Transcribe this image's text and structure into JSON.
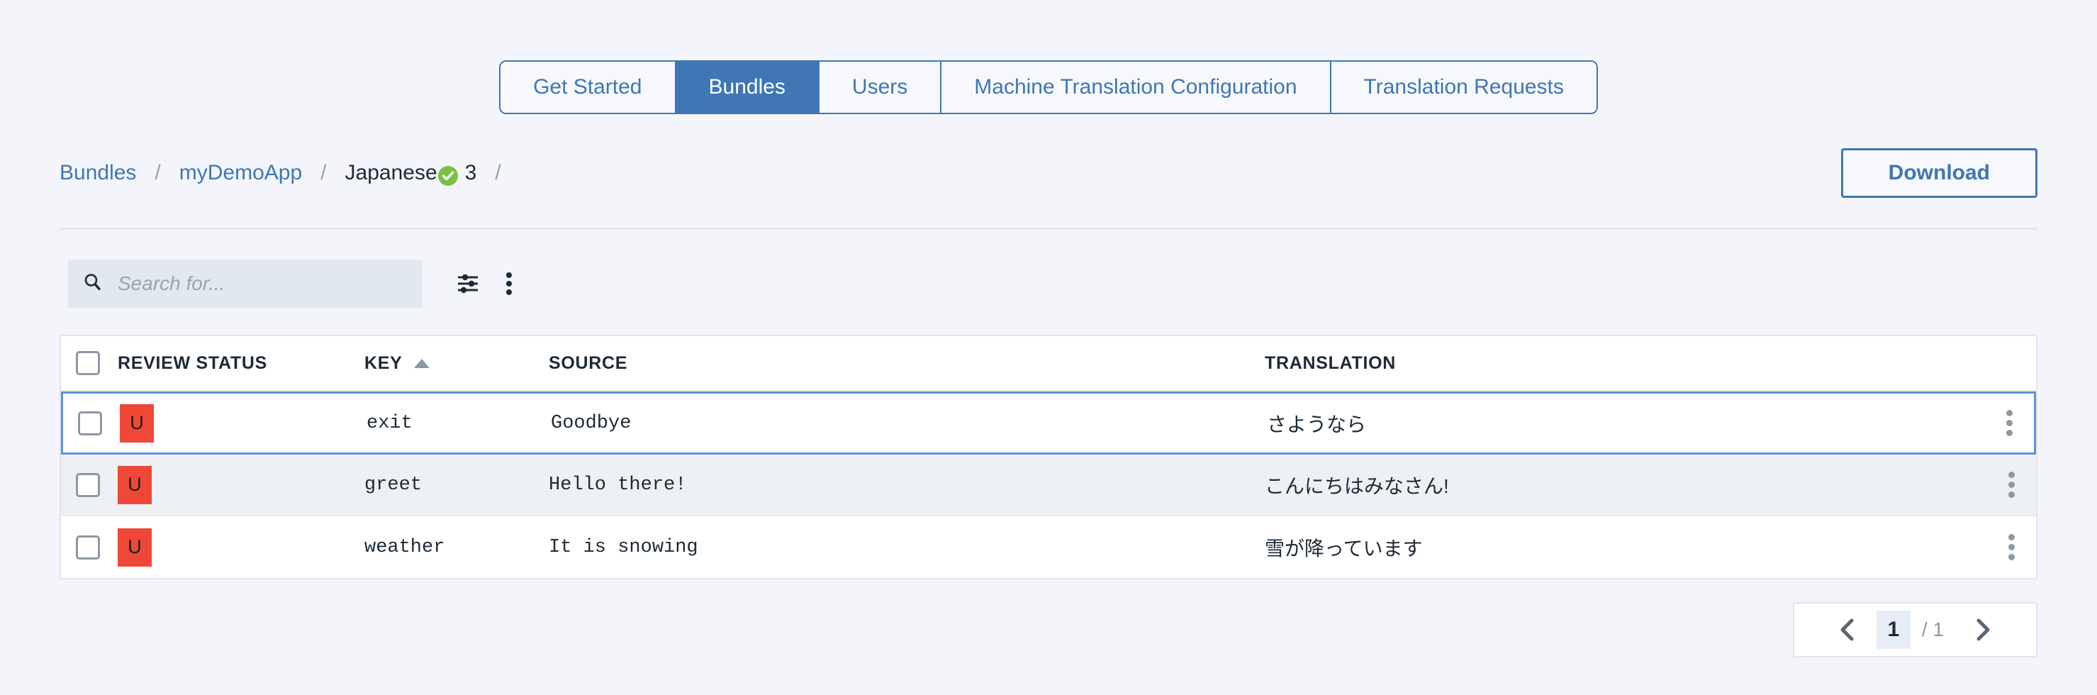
{
  "colors": {
    "accent_blue": "#3f76b5",
    "page_bg": "#f4f5fa",
    "badge_red": "#ef4836",
    "check_green": "#7ac143",
    "selected_border": "#5b93dd",
    "row_alt_bg": "#eef1f4"
  },
  "tabs": [
    {
      "label": "Get Started",
      "active": false
    },
    {
      "label": "Bundles",
      "active": true
    },
    {
      "label": "Users",
      "active": false
    },
    {
      "label": "Machine Translation Configuration",
      "active": false
    },
    {
      "label": "Translation Requests",
      "active": false
    }
  ],
  "breadcrumb": {
    "items": [
      {
        "label": "Bundles",
        "type": "link"
      },
      {
        "label": "myDemoApp",
        "type": "link"
      },
      {
        "label": "Japanese",
        "type": "current"
      }
    ],
    "separator": "/",
    "trailing_separator": "/",
    "count": "3",
    "status_icon": "check-circle-icon"
  },
  "header_actions": {
    "download_label": "Download"
  },
  "toolbar": {
    "search_placeholder": "Search for...",
    "search_value": "",
    "search_icon": "search-icon",
    "filter_icon": "filter-sliders-icon",
    "overflow_icon": "kebab-menu-icon"
  },
  "table": {
    "columns": [
      {
        "label": "REVIEW STATUS",
        "sorted": false
      },
      {
        "label": "KEY",
        "sorted": true,
        "sort_direction": "asc"
      },
      {
        "label": "SOURCE",
        "sorted": false
      },
      {
        "label": "TRANSLATION",
        "sorted": false
      }
    ],
    "rows": [
      {
        "status_badge": "U",
        "key": "exit",
        "source": "Goodbye",
        "translation": "さようなら",
        "checked": false,
        "selected": true
      },
      {
        "status_badge": "U",
        "key": "greet",
        "source": "Hello there!",
        "translation": "こんにちはみなさん!",
        "checked": false,
        "selected": false
      },
      {
        "status_badge": "U",
        "key": "weather",
        "source": "It is snowing",
        "translation": "雪が降っています",
        "checked": false,
        "selected": false
      }
    ]
  },
  "pagination": {
    "prev_icon": "chevron-left-icon",
    "next_icon": "chevron-right-icon",
    "current_page": "1",
    "total_pages": "/ 1"
  }
}
